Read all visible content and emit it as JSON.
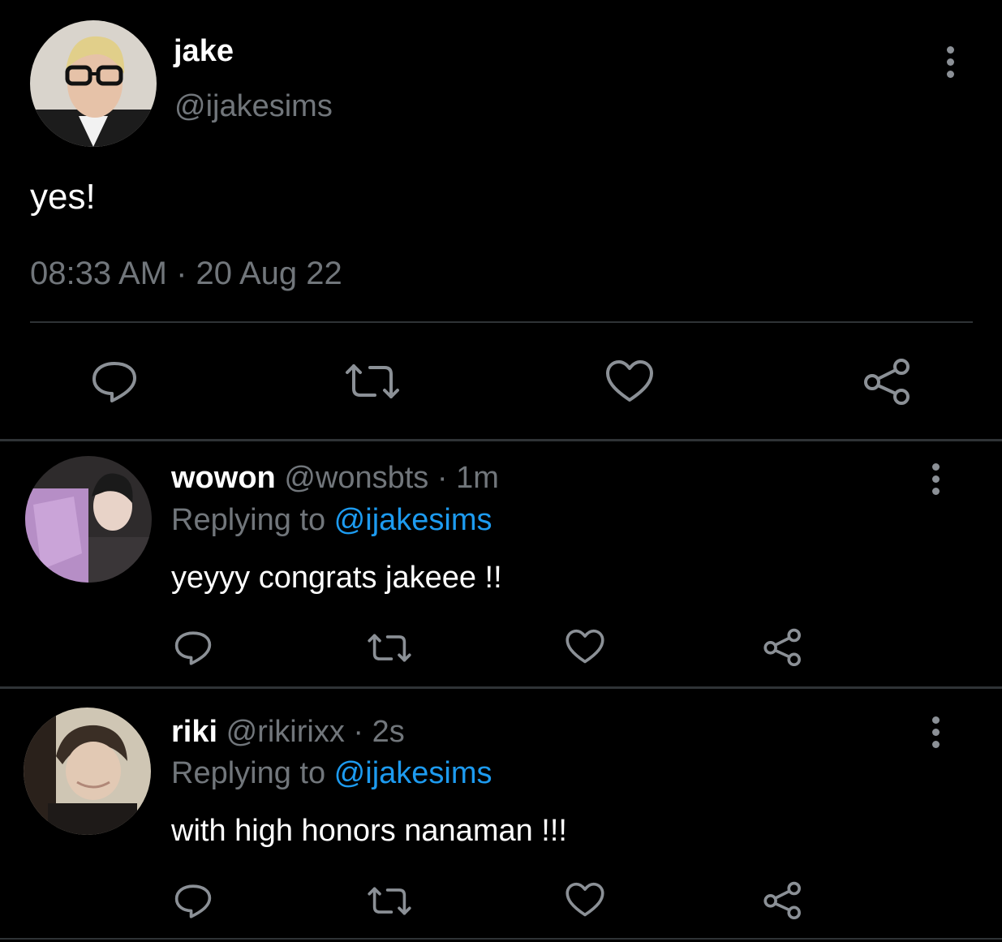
{
  "main_tweet": {
    "display_name": "jake",
    "handle": "@ijakesims",
    "text": "yes!",
    "timestamp": "08:33 AM · 20 Aug 22",
    "actions": [
      "reply-icon",
      "retweet-icon",
      "like-icon",
      "share-icon"
    ]
  },
  "replies": [
    {
      "display_name": "wowon",
      "handle": "@wonsbts",
      "time": "1m",
      "separator": " · ",
      "replying_prefix": "Replying to ",
      "replying_to": "@ijakesims",
      "text": "yeyyy congrats jakeee !!"
    },
    {
      "display_name": "riki",
      "handle": "@rikirixx",
      "time": "2s",
      "separator": " · ",
      "replying_prefix": "Replying to ",
      "replying_to": "@ijakesims",
      "text": "with high honors nanaman !!!"
    }
  ],
  "colors": {
    "background": "#000000",
    "muted": "#71767b",
    "link": "#1d9bf0",
    "icon": "#8b9096"
  }
}
